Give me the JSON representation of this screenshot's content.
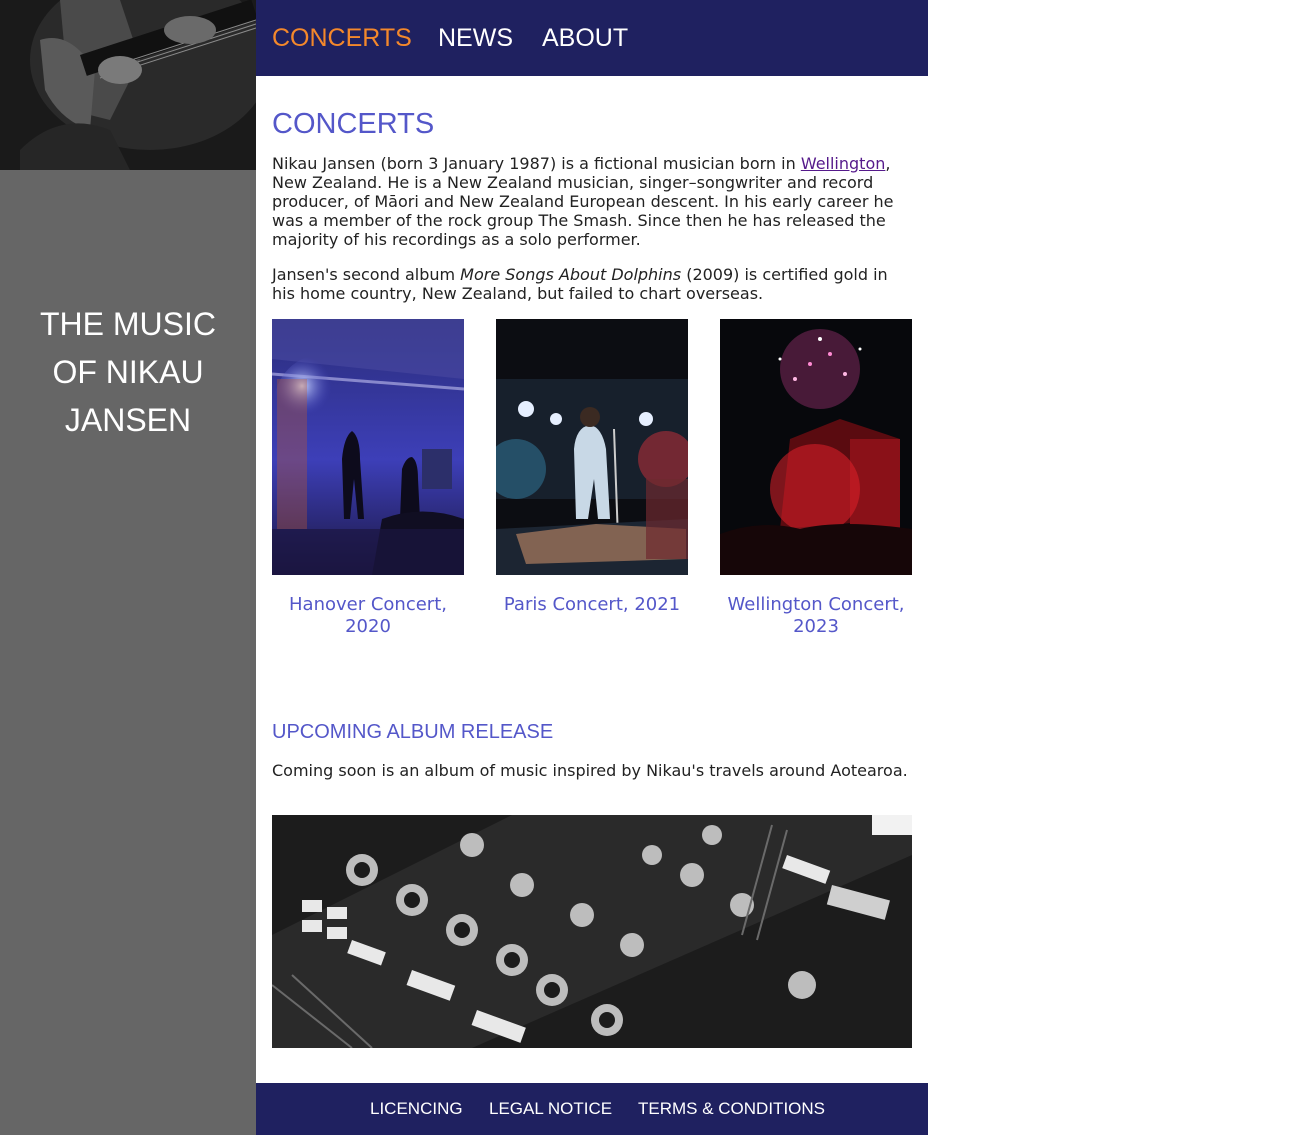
{
  "sidebar": {
    "title_line1": "THE MUSIC",
    "title_line2": "OF NIKAU",
    "title_line3": "JANSEN"
  },
  "nav": {
    "items": [
      {
        "label": "CONCERTS",
        "active": true
      },
      {
        "label": "NEWS",
        "active": false
      },
      {
        "label": "ABOUT",
        "active": false
      }
    ]
  },
  "main": {
    "heading": "CONCERTS",
    "intro": {
      "before_link": "Nikau Jansen (born 3 January 1987) is a fictional musician born in ",
      "link_text": "Wellington",
      "after_link": ", New Zealand. He is a New Zealand musician, singer–songwriter and record producer, of Māori and New Zealand European descent. In his early career he was a member of the rock group The Smash. Since then he has released the majority of his recordings as a solo performer."
    },
    "album_para": {
      "before": "Jansen's second album ",
      "title": "More Songs About Dolphins",
      "after": " (2009) is certified gold in his home country, New Zealand, but failed to chart overseas."
    },
    "gallery": [
      {
        "caption": "Hanover Concert, 2020"
      },
      {
        "caption": "Paris Concert, 2021"
      },
      {
        "caption": "Wellington Concert, 2023"
      }
    ],
    "upcoming_heading": "UPCOMING ALBUM RELEASE",
    "upcoming_text": "Coming soon is an album of music inspired by Nikau's travels around Aotearoa."
  },
  "footer": {
    "links": [
      "LICENCING",
      "LEGAL NOTICE",
      "TERMS & CONDITIONS"
    ]
  },
  "colors": {
    "nav_bg": "#1f2160",
    "active_nav": "#f4882b",
    "heading": "#5457c9",
    "sidebar_bg": "#666666"
  }
}
